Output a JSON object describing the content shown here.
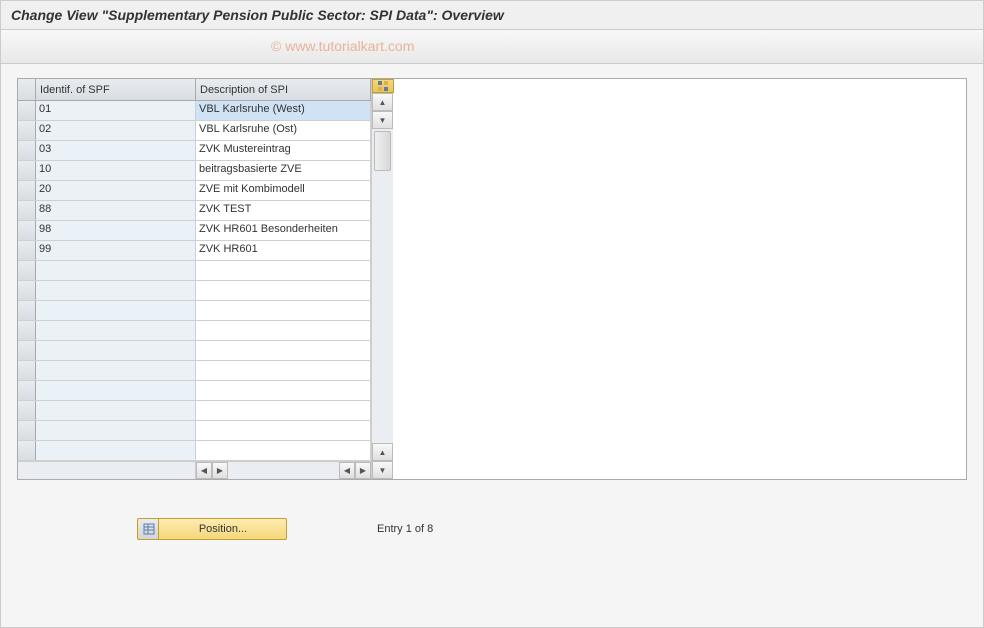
{
  "header": {
    "title": "Change View \"Supplementary Pension Public Sector: SPI Data\": Overview"
  },
  "watermark": "© www.tutorialkart.com",
  "table": {
    "columns": {
      "identif": "Identif. of SPF",
      "description": "Description of SPI"
    },
    "rows": [
      {
        "id": "01",
        "desc": "VBL Karlsruhe (West)",
        "selected": true
      },
      {
        "id": "02",
        "desc": "VBL Karlsruhe (Ost)",
        "selected": false
      },
      {
        "id": "03",
        "desc": "ZVK Mustereintrag",
        "selected": false
      },
      {
        "id": "10",
        "desc": "beitragsbasierte ZVE",
        "selected": false
      },
      {
        "id": "20",
        "desc": "ZVE mit Kombimodell",
        "selected": false
      },
      {
        "id": "88",
        "desc": "ZVK TEST",
        "selected": false
      },
      {
        "id": "98",
        "desc": "ZVK HR601 Besonderheiten",
        "selected": false
      },
      {
        "id": "99",
        "desc": "ZVK HR601",
        "selected": false
      }
    ],
    "empty_row_count": 10
  },
  "footer": {
    "position_label": "Position...",
    "entry_status": "Entry 1 of 8"
  },
  "icons": {
    "settings": "settings-icon",
    "position": "position-icon"
  }
}
